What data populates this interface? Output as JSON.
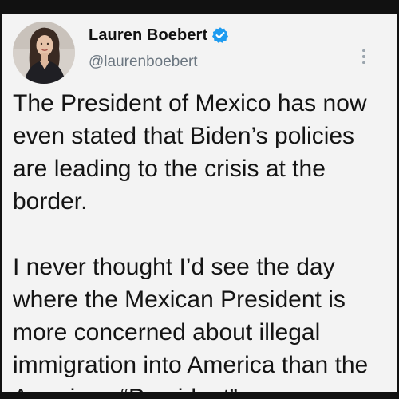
{
  "tweet": {
    "author": {
      "display_name": "Lauren Boebert",
      "handle": "@laurenboebert",
      "verified": true,
      "verified_icon": "verified-badge-icon",
      "verified_color": "#1d9bf0"
    },
    "menu_icon": "more-options-icon",
    "paragraphs": [
      {
        "lines": [
          "The President of Mexico has now",
          "even stated that Biden’s policies",
          "are leading to the crisis at the",
          "border."
        ]
      },
      {
        "lines": [
          "I never thought I’d see the day",
          "where the Mexican President is",
          "more concerned about illegal",
          "immigration into America than the",
          "American “President”."
        ]
      }
    ]
  },
  "colors": {
    "background": "#f3f3f3",
    "border": "#111111",
    "text": "#141414",
    "handle": "#6b7680"
  }
}
